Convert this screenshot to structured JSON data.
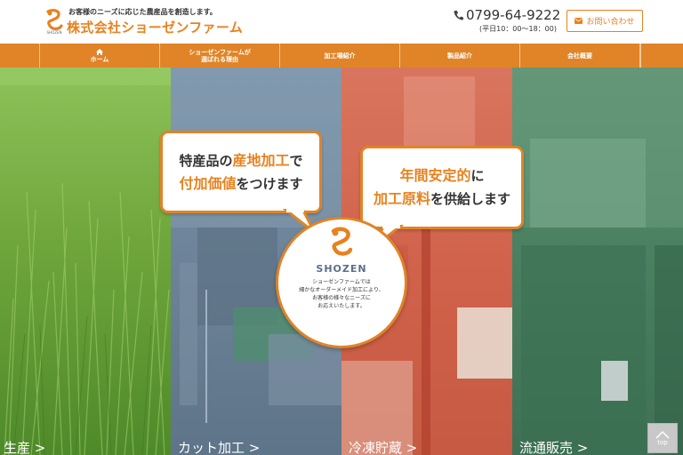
{
  "header": {
    "tagline": "お客様のニーズに応じた農産品を創造します。",
    "company_name": "株式会社ショーゼンファーム",
    "logo_text": "SHOZEN",
    "phone": "0799-64-9222",
    "hours": "(平日10：00～18：00)",
    "contact_label": "お問い合わせ"
  },
  "nav": {
    "items": [
      {
        "label": "ホーム"
      },
      {
        "label_line1": "ショーゼンファームが",
        "label_line2": "選ばれる理由"
      },
      {
        "label": "加工場紹介"
      },
      {
        "label": "製品紹介"
      },
      {
        "label": "会社概要"
      }
    ]
  },
  "hero": {
    "bubble1": {
      "pre": "特産品の",
      "hl": "産地加工",
      "post": "で",
      "line2_hl": "付加価値",
      "line2_post": "をつけます"
    },
    "bubble2": {
      "hl1": "年間安定的",
      "post1": "に",
      "hl2": "加工原料",
      "post2": "を供給します"
    },
    "circle": {
      "brand": "SHOZEN",
      "desc_line1": "ショーゼンファームでは",
      "desc_line2": "細かなオーダーメイド加工により、",
      "desc_line3": "お客様の様々なニーズに",
      "desc_line4": "お応えいたします。"
    },
    "panels": [
      {
        "label": "生産 >"
      },
      {
        "label": "カット加工 >"
      },
      {
        "label": "冷凍貯蔵 >"
      },
      {
        "label": "流通販売 >"
      }
    ]
  },
  "top_button": {
    "label": "top"
  },
  "colors": {
    "accent": "#e08427",
    "brand_orange": "#e8821e"
  }
}
